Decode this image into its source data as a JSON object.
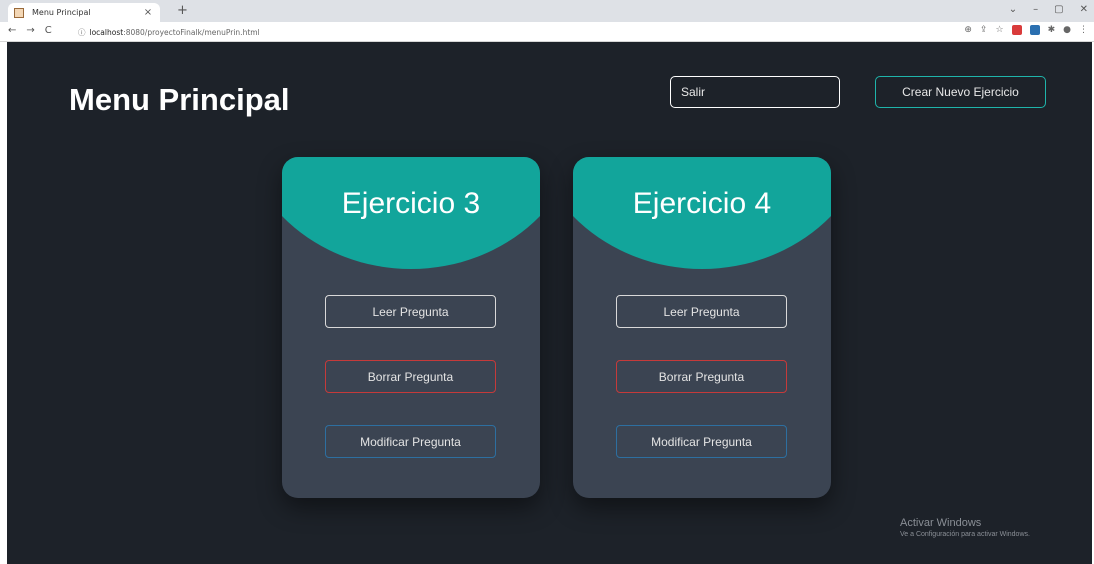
{
  "browser": {
    "tab_title": "Menu Principal",
    "tab_close": "×",
    "new_tab": "+",
    "url_host": "localhost",
    "url_rest": ":8080/proyectoFinalk/menuPrin.html",
    "nav": {
      "back": "←",
      "forward": "→",
      "reload": "C"
    },
    "window_controls": {
      "chevron": "⌄",
      "minimize": "–",
      "restore": "▢",
      "close": "✕"
    }
  },
  "page": {
    "title": "Menu Principal",
    "salir_placeholder": "Salir",
    "crear_label": "Crear Nuevo Ejercicio"
  },
  "cards": [
    {
      "title": "Ejercicio 3",
      "leer": "Leer Pregunta",
      "borrar": "Borrar Pregunta",
      "modificar": "Modificar Pregunta"
    },
    {
      "title": "Ejercicio 4",
      "leer": "Leer Pregunta",
      "borrar": "Borrar Pregunta",
      "modificar": "Modificar Pregunta"
    }
  ],
  "watermark": {
    "line1": "Activar Windows",
    "line2": "Ve a Configuración para activar Windows."
  },
  "colors": {
    "page_bg": "#1d2229",
    "card_bg": "#3b4452",
    "accent_teal": "#12a59b",
    "danger": "#c53a3a",
    "info": "#2d6fa0"
  }
}
